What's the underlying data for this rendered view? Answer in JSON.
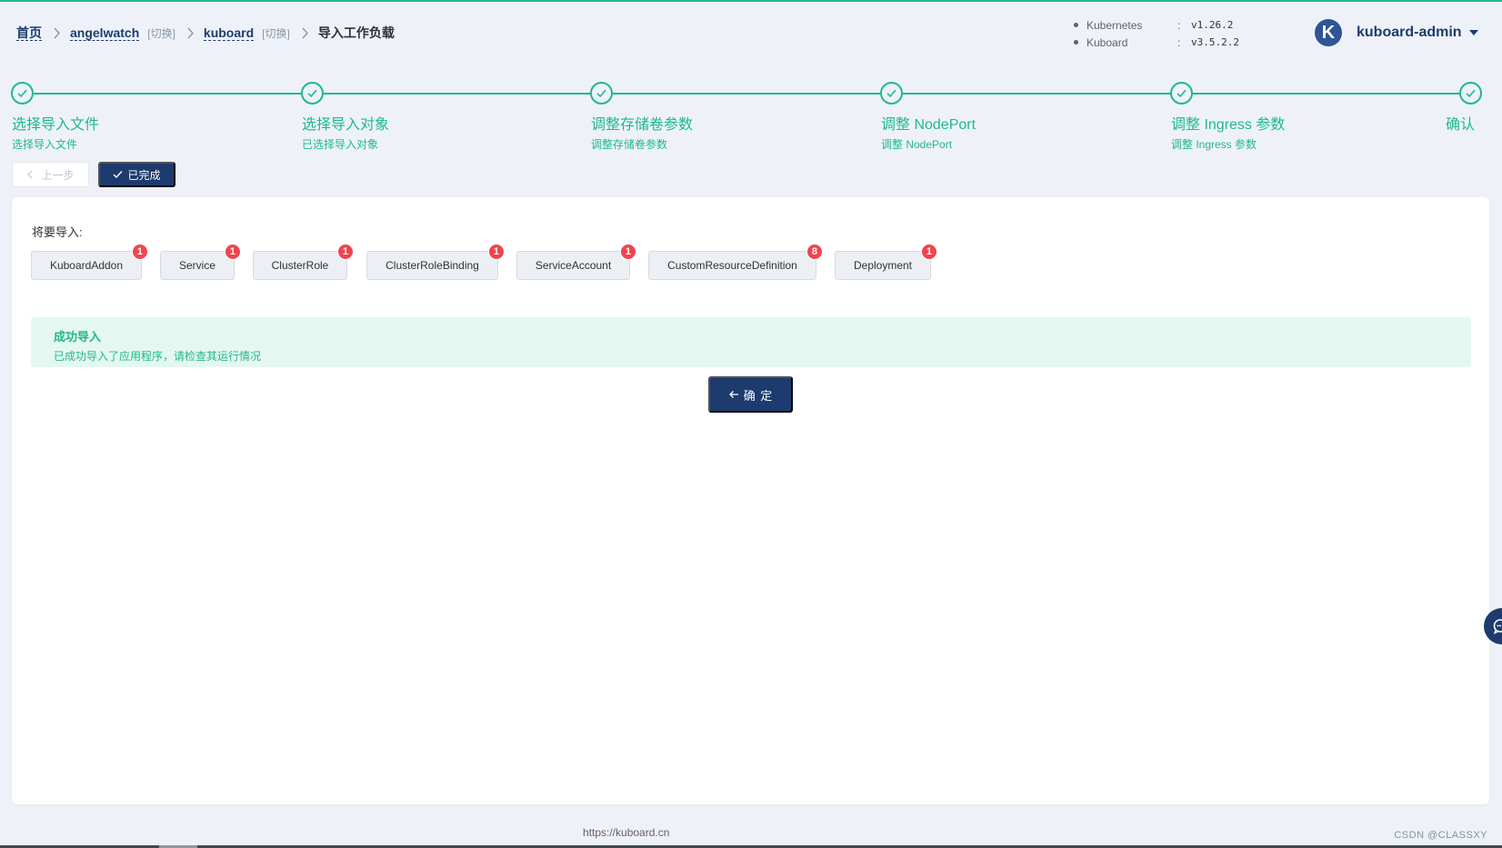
{
  "breadcrumb": {
    "home": "首页",
    "namespace": "angelwatch",
    "namespace_switch": "[切换]",
    "cluster": "kuboard",
    "cluster_switch": "[切换]",
    "current": "导入工作负载"
  },
  "versions": [
    {
      "name": "Kubernetes",
      "colon": ":",
      "value": "v1.26.2"
    },
    {
      "name": "Kuboard",
      "colon": ":",
      "value": "v3.5.2.2"
    }
  ],
  "user": {
    "avatar_letter": "K",
    "name": "kuboard-admin"
  },
  "steps": [
    {
      "title": "选择导入文件",
      "desc": "选择导入文件",
      "status": "done"
    },
    {
      "title": "选择导入对象",
      "desc": "已选择导入对象",
      "status": "done"
    },
    {
      "title": "调整存储卷参数",
      "desc": "调整存储卷参数",
      "status": "done"
    },
    {
      "title": "调整 NodePort",
      "desc": "调整 NodePort",
      "status": "done"
    },
    {
      "title": "调整 Ingress 参数",
      "desc": "调整 Ingress 参数",
      "status": "done"
    },
    {
      "title": "确认",
      "desc": "",
      "status": "done"
    }
  ],
  "actions": {
    "prev_label": "上一步",
    "done_label": "已完成"
  },
  "import": {
    "label": "将要导入:",
    "tags": [
      {
        "label": "KuboardAddon",
        "count": "1"
      },
      {
        "label": "Service",
        "count": "1"
      },
      {
        "label": "ClusterRole",
        "count": "1"
      },
      {
        "label": "ClusterRoleBinding",
        "count": "1"
      },
      {
        "label": "ServiceAccount",
        "count": "1"
      },
      {
        "label": "CustomResourceDefinition",
        "count": "8"
      },
      {
        "label": "Deployment",
        "count": "1"
      }
    ]
  },
  "alert": {
    "title": "成功导入",
    "description": "已成功导入了应用程序，请检查其运行情况"
  },
  "confirm_label": "确 定",
  "footer": {
    "url": "https://kuboard.cn",
    "watermark": "CSDN @CLASSXY"
  },
  "colors": {
    "primary": "#1d3b6e",
    "success": "#1fb98a",
    "badge": "#f0444e",
    "background": "#eef2f8"
  }
}
